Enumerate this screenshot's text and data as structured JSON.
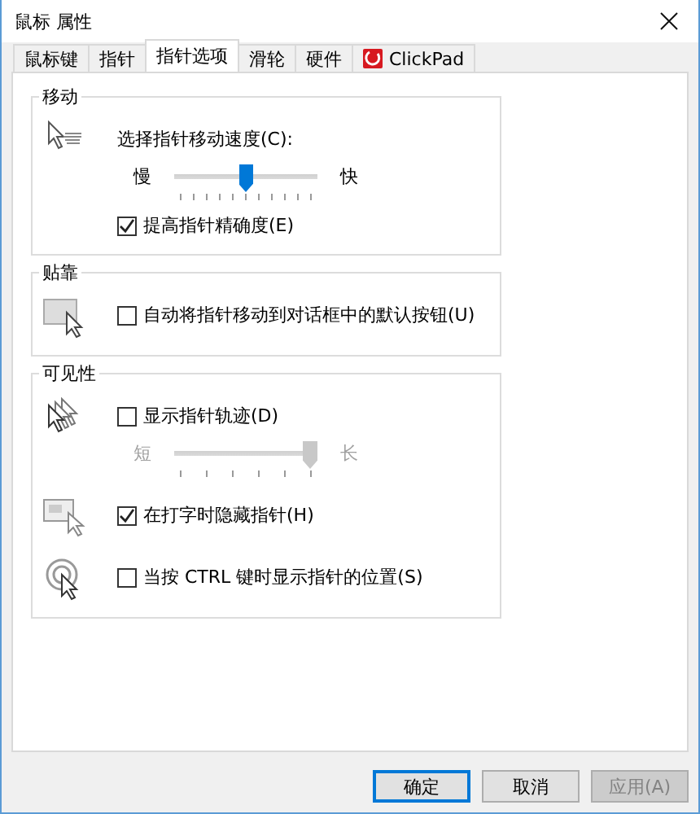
{
  "window": {
    "title": "鼠标 属性"
  },
  "tabs": [
    {
      "label": "鼠标键",
      "selected": false,
      "kind": "text"
    },
    {
      "label": "指针",
      "selected": false,
      "kind": "text"
    },
    {
      "label": "指针选项",
      "selected": true,
      "kind": "text"
    },
    {
      "label": "滑轮",
      "selected": false,
      "kind": "text"
    },
    {
      "label": "硬件",
      "selected": false,
      "kind": "text"
    },
    {
      "label": "ClickPad",
      "selected": false,
      "kind": "brand"
    }
  ],
  "groups": [
    {
      "title": "移动",
      "sections": [
        {
          "items": [
            {
              "kind": "label",
              "text": "选择指针移动速度(C):"
            },
            {
              "kind": "slider",
              "min_label": "慢",
              "max_label": "快",
              "level": 0.5,
              "disabled": false
            },
            {
              "kind": "checkbox",
              "label": "提高指针精确度(E)",
              "checked": true
            }
          ]
        }
      ]
    },
    {
      "title": "贴靠",
      "sections": [
        {
          "items": [
            {
              "kind": "checkbox",
              "label": "自动将指针移动到对话框中的默认按钮(U)",
              "checked": false
            }
          ]
        }
      ]
    },
    {
      "title": "可见性",
      "sections": [
        {
          "items": [
            {
              "kind": "checkbox",
              "label": "显示指针轨迹(D)",
              "checked": false
            },
            {
              "kind": "slider",
              "min_label": "短",
              "max_label": "长",
              "level": 1,
              "disabled": true
            }
          ]
        },
        {
          "items": [
            {
              "kind": "checkbox",
              "label": "在打字时隐藏指针(H)",
              "checked": true
            }
          ]
        },
        {
          "items": [
            {
              "kind": "checkbox",
              "label": "当按 CTRL 键时显示指针的位置(S)",
              "checked": false
            }
          ]
        }
      ]
    }
  ],
  "buttons": [
    {
      "label": "确定",
      "default": true,
      "disabled": false
    },
    {
      "label": "取消",
      "default": false,
      "disabled": false
    },
    {
      "label": "应用(A)",
      "default": false,
      "disabled": true
    }
  ]
}
